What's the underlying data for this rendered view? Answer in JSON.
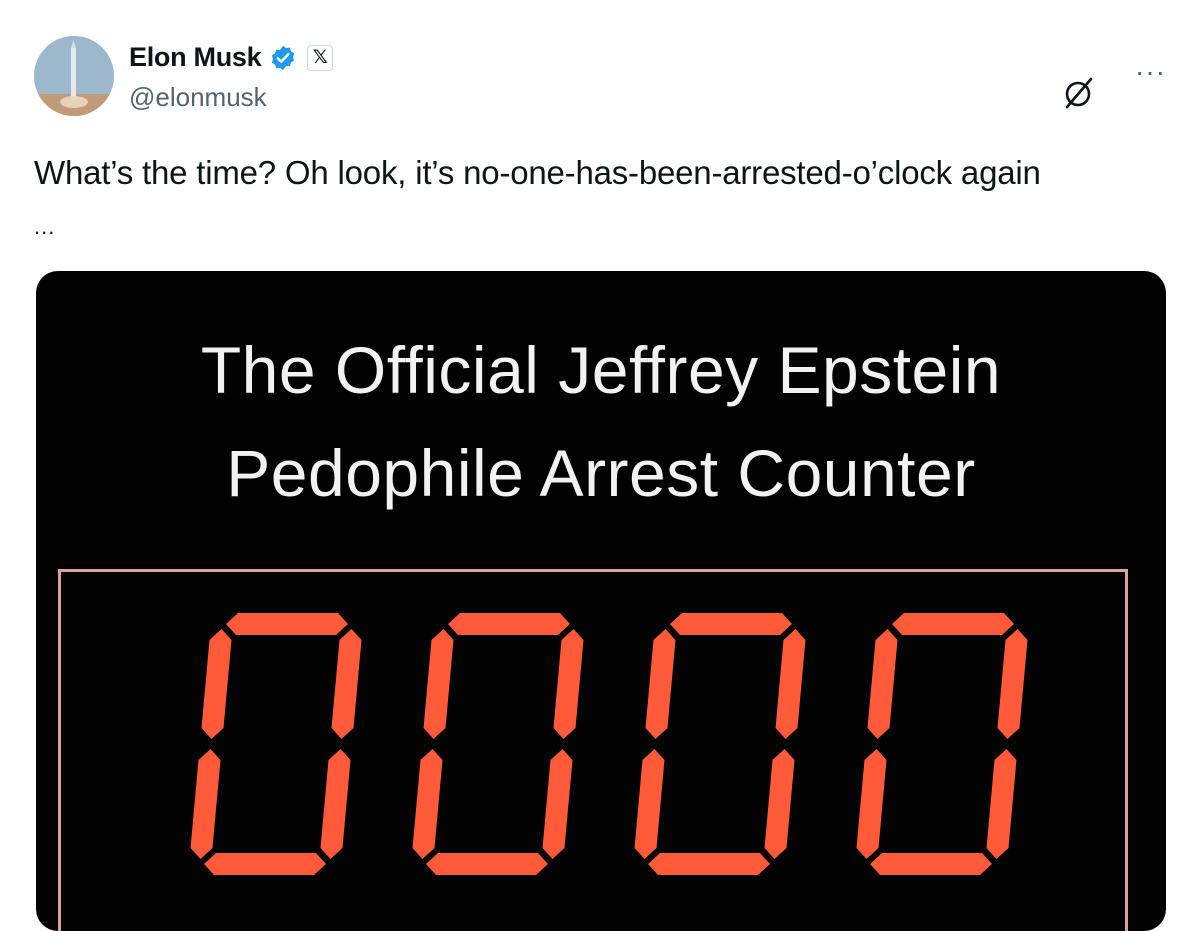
{
  "tweet": {
    "author_name": "Elon Musk",
    "handle": "@elonmusk",
    "text": "What’s the time? Oh look, it’s no-one-has-been-arrested-o’clock again",
    "truncation": "..."
  },
  "icons": {
    "avatar": "avatar",
    "verified": "verified-badge-icon",
    "affiliation": "x-logo-icon",
    "grok": "grok-icon",
    "more": "more-icon"
  },
  "header": {
    "x_badge_label": "𝕏",
    "more_label": "···"
  },
  "media": {
    "title": "The Official Jeffrey Epstein\nPedophile Arrest Counter",
    "counter_value": "0000"
  },
  "colors": {
    "verified_blue": "#1d9bf0",
    "digit_red": "#ff5a3a",
    "media_bg": "#030303"
  }
}
